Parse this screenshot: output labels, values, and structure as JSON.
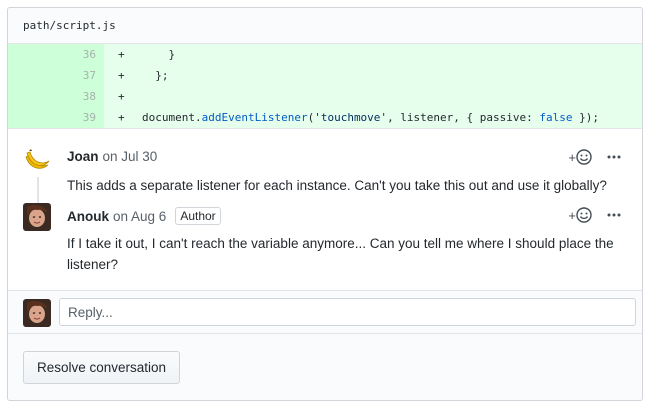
{
  "file": {
    "path": "path/script.js"
  },
  "diff": {
    "lines": [
      {
        "num": "36",
        "marker": "+",
        "code": "    }"
      },
      {
        "num": "37",
        "marker": "+",
        "code": "  };"
      },
      {
        "num": "38",
        "marker": "+",
        "code": ""
      },
      {
        "num": "39",
        "marker": "+",
        "code_parts": {
          "p1": "document.",
          "fn": "addEventListener",
          "p2": "(",
          "str": "'touchmove'",
          "p3": ", listener, { passive: ",
          "kw": "false",
          "p4": " });"
        }
      }
    ]
  },
  "comments": [
    {
      "author": "Joan",
      "timestamp": "on Jul 30",
      "body": "This adds a separate listener for each instance. Can't you take this out and use it globally?"
    },
    {
      "author": "Anouk",
      "timestamp": "on Aug 6",
      "badge": "Author",
      "body": "If I take it out, I can't reach the variable anymore... Can you tell me where I should place the listener?"
    }
  ],
  "actions": {
    "add_reaction": "+",
    "more": "···"
  },
  "reply": {
    "placeholder": "Reply..."
  },
  "resolve": {
    "label": "Resolve conversation"
  },
  "colors": {
    "diff_bg": "#e6ffed",
    "gutter_bg": "#cdffd8",
    "border": "#d1d5da",
    "muted": "#586069"
  }
}
